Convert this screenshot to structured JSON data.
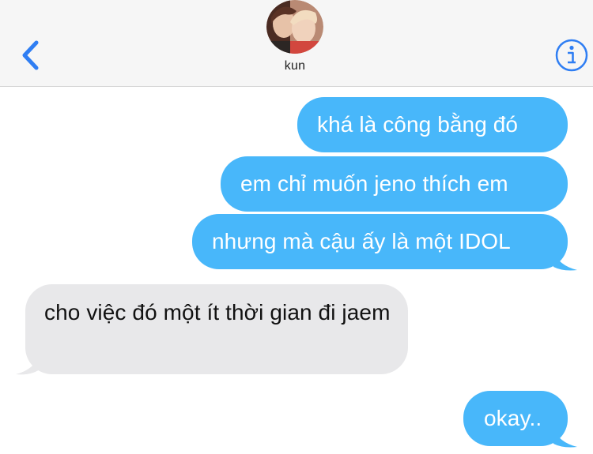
{
  "header": {
    "contact_name": "kun",
    "back_icon": "chevron-left-icon",
    "info_icon": "info-circle-icon",
    "accent_color": "#2f7ef3"
  },
  "messages": [
    {
      "direction": "outgoing",
      "text": "khá là công bằng đó"
    },
    {
      "direction": "outgoing",
      "text": "em chỉ muốn jeno thích em"
    },
    {
      "direction": "outgoing",
      "text": "nhưng mà cậu ấy là một IDOL"
    },
    {
      "direction": "incoming",
      "text": "cho việc đó một ít thời gian đi jaem"
    },
    {
      "direction": "outgoing",
      "text": "okay.."
    }
  ],
  "colors": {
    "outgoing_bubble": "#48b7fa",
    "incoming_bubble": "#e8e8ea",
    "header_bg": "#f6f6f6"
  }
}
